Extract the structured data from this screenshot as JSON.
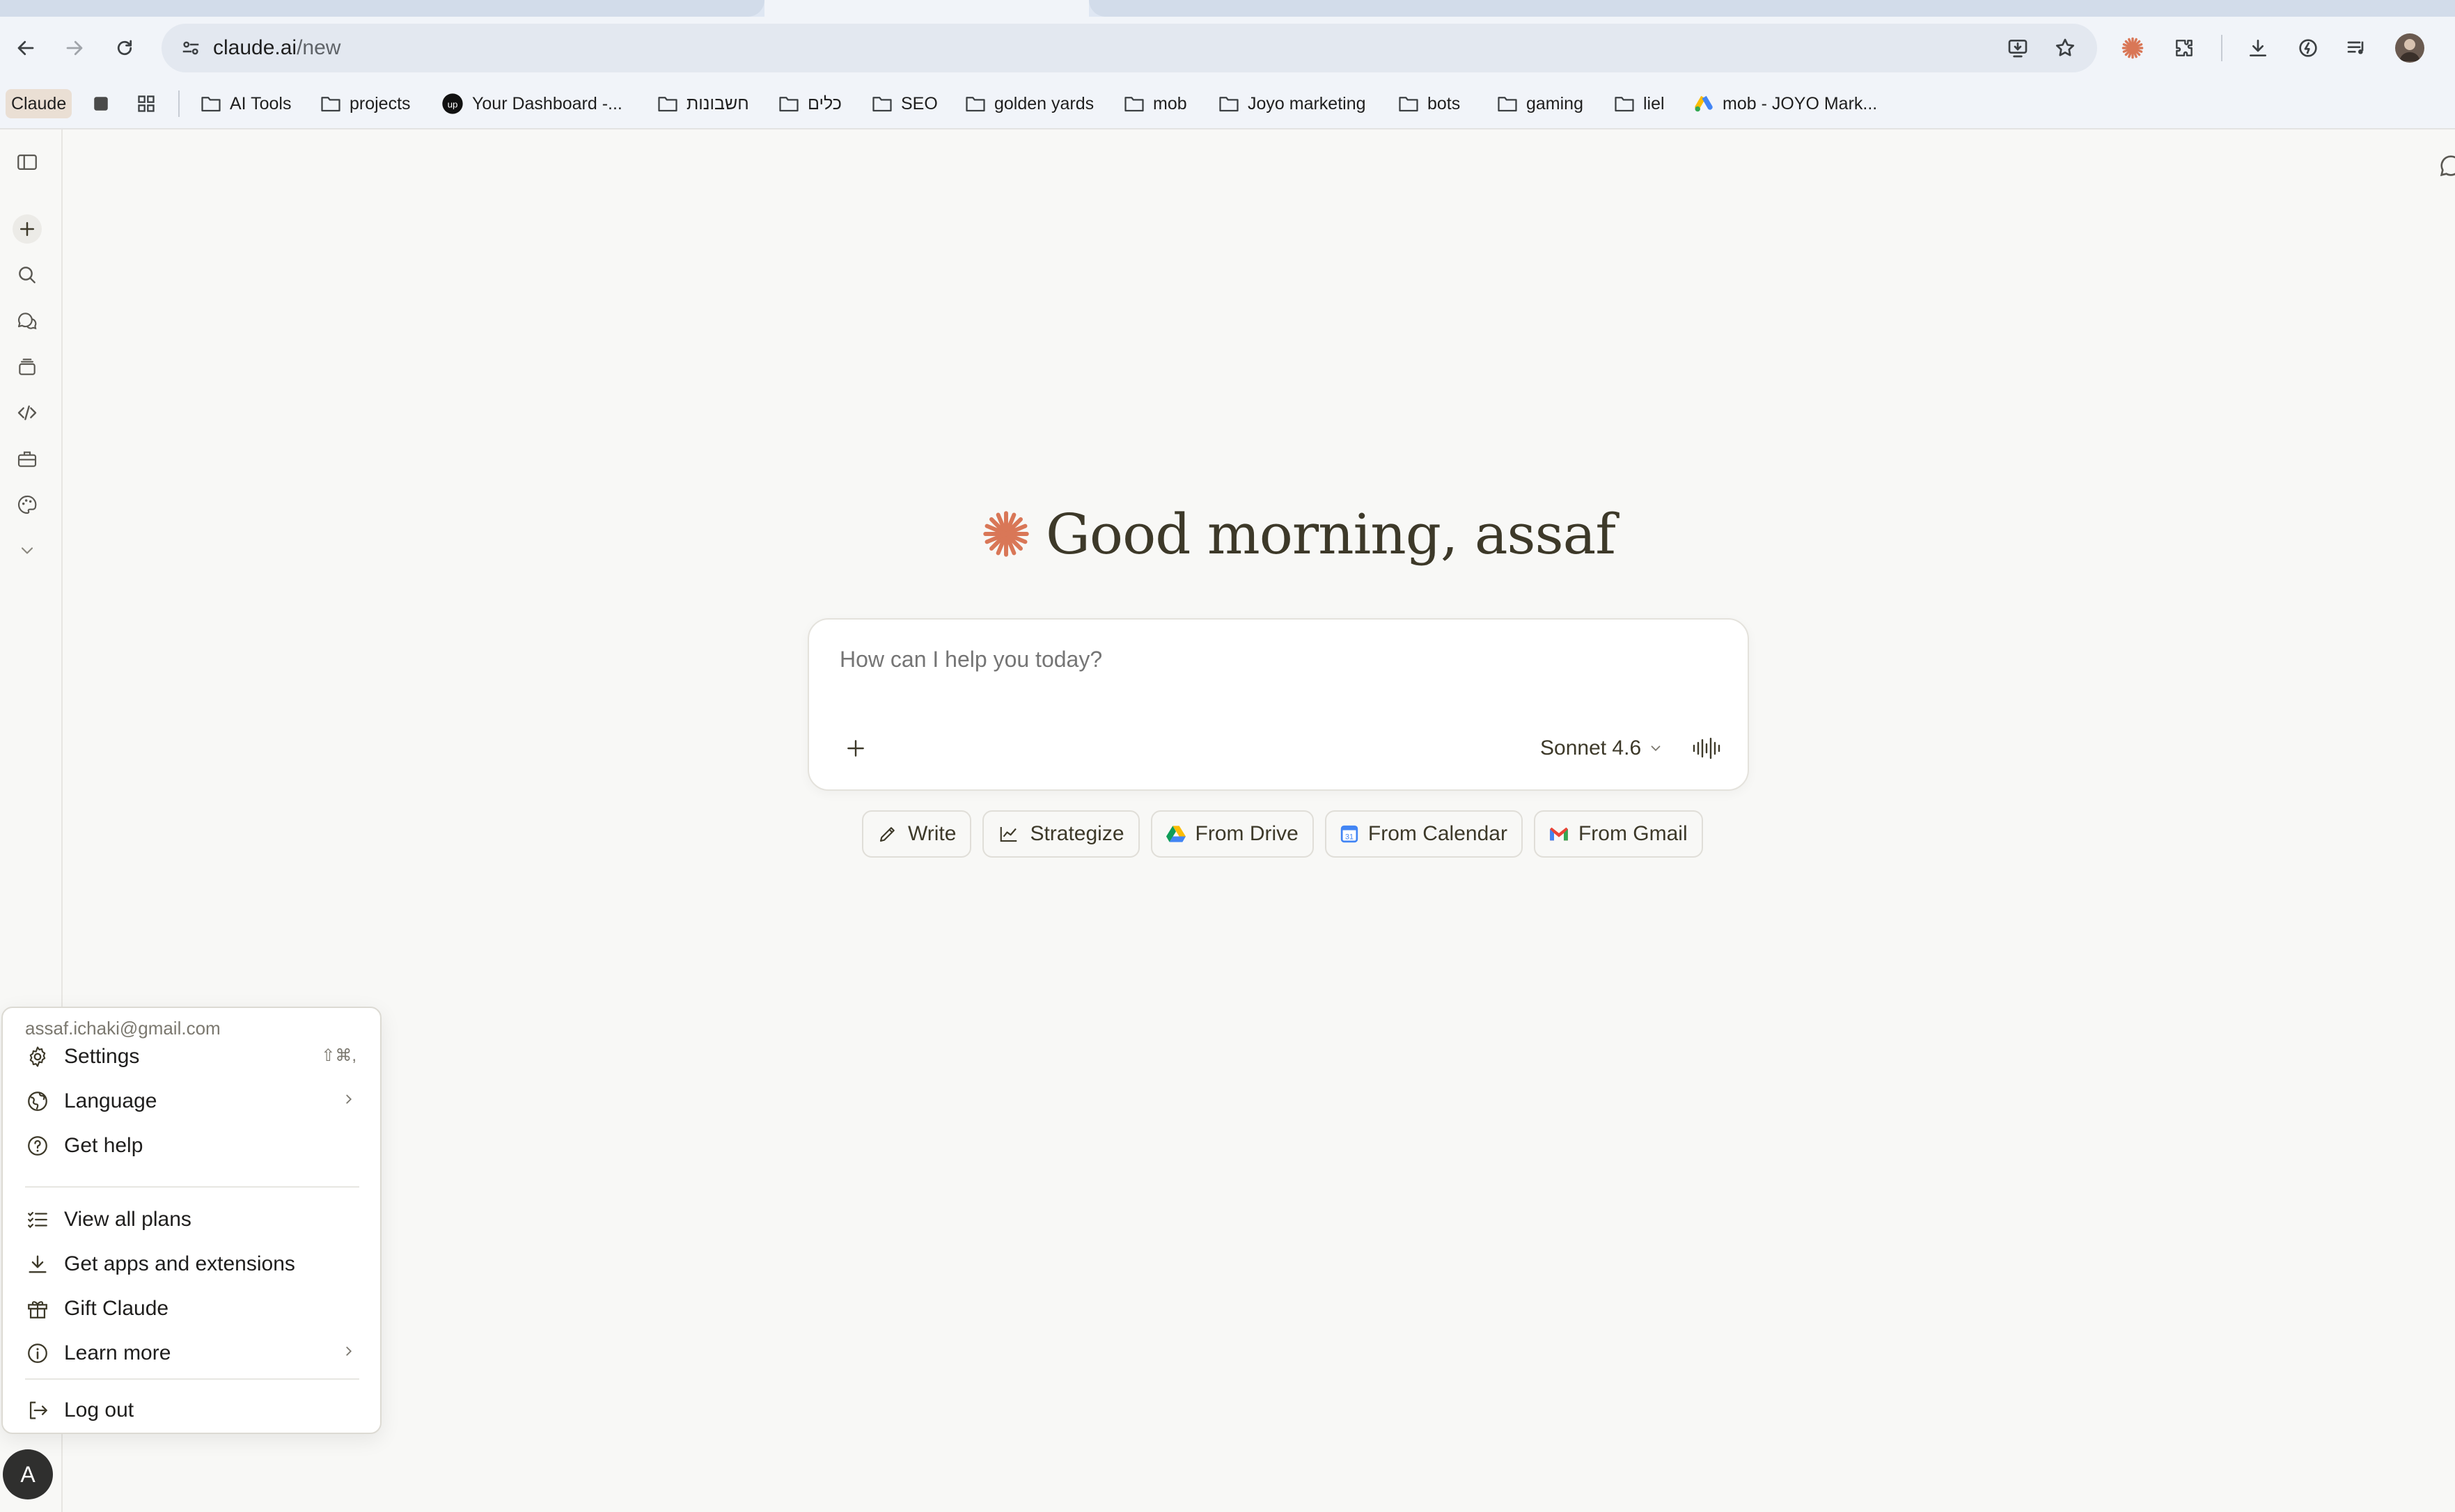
{
  "browser": {
    "url_host": "claude.ai",
    "url_path": "/new",
    "bookmarks": [
      {
        "label": "Claude",
        "type": "app"
      },
      {
        "label": "AI Tools",
        "type": "folder"
      },
      {
        "label": "projects",
        "type": "folder"
      },
      {
        "label": "Your Dashboard -...",
        "type": "site"
      },
      {
        "label": "חשבונות",
        "type": "folder"
      },
      {
        "label": "כלים",
        "type": "folder"
      },
      {
        "label": "SEO",
        "type": "folder"
      },
      {
        "label": "golden yards",
        "type": "folder"
      },
      {
        "label": "mob",
        "type": "folder"
      },
      {
        "label": "Joyo marketing",
        "type": "folder"
      },
      {
        "label": "bots",
        "type": "folder"
      },
      {
        "label": "gaming",
        "type": "folder"
      },
      {
        "label": "liel",
        "type": "folder"
      },
      {
        "label": "mob - JOYO Mark...",
        "type": "site"
      }
    ]
  },
  "main": {
    "greeting": "Good morning, assaf",
    "composer_placeholder": "How can I help you today?",
    "model": "Sonnet 4.6",
    "chips": [
      {
        "label": "Write",
        "icon": "pencil-icon"
      },
      {
        "label": "Strategize",
        "icon": "chart-line-icon"
      },
      {
        "label": "From Drive",
        "icon": "google-drive-icon"
      },
      {
        "label": "From Calendar",
        "icon": "google-calendar-icon"
      },
      {
        "label": "From Gmail",
        "icon": "gmail-icon"
      }
    ]
  },
  "account_menu": {
    "email": "assaf.ichaki@gmail.com",
    "items": [
      {
        "label": "Settings",
        "shortcut": "⇧⌘,"
      },
      {
        "label": "Language"
      },
      {
        "label": "Get help"
      },
      {
        "label": "View all plans"
      },
      {
        "label": "Get apps and extensions"
      },
      {
        "label": "Gift Claude"
      },
      {
        "label": "Learn more"
      },
      {
        "label": "Log out"
      }
    ]
  },
  "user": {
    "initial": "A"
  },
  "colors": {
    "accent": "#d97757",
    "background": "#f8f8f6"
  }
}
